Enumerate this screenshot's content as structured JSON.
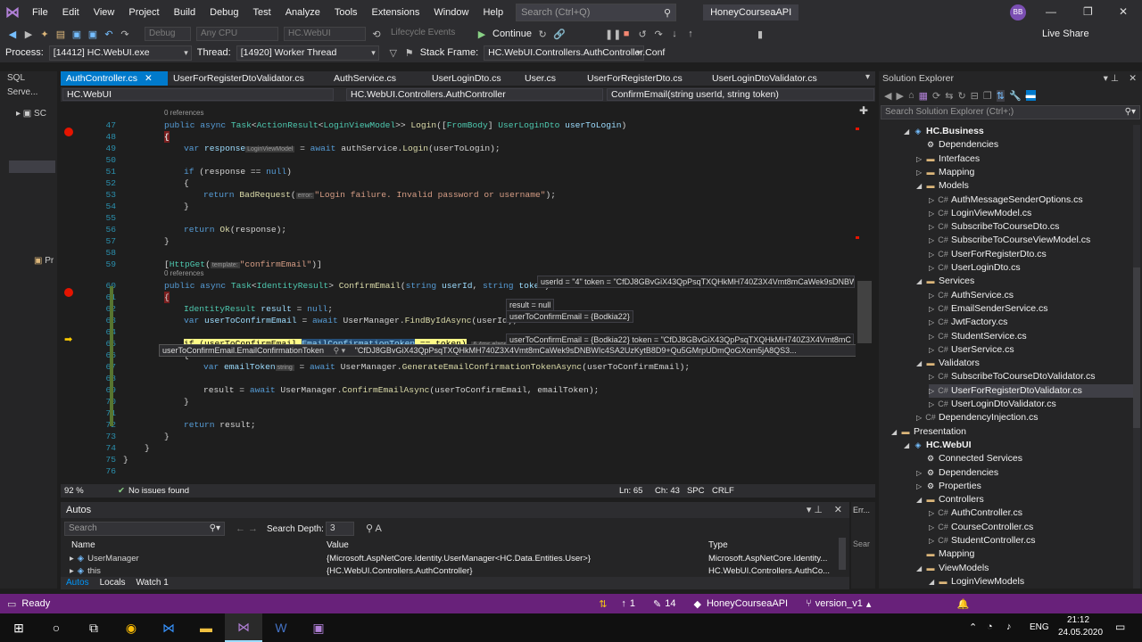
{
  "menubar": {
    "items": [
      "File",
      "Edit",
      "View",
      "Project",
      "Build",
      "Debug",
      "Test",
      "Analyze",
      "Tools",
      "Extensions",
      "Window",
      "Help"
    ],
    "search_placeholder": "Search (Ctrl+Q)",
    "solution_name": "HoneyCourseaAPI",
    "avatar_initials": "BB"
  },
  "toolbar1": {
    "config": "Debug",
    "platform": "Any CPU",
    "project": "HC.WebUI",
    "lifecycle": "Lifecycle Events",
    "continue_label": "Continue",
    "live_share": "Live Share"
  },
  "toolbar2": {
    "process_label": "Process:",
    "process_value": "[14412] HC.WebUI.exe",
    "thread_label": "Thread:",
    "thread_value": "[14920] Worker Thread",
    "stackframe_label": "Stack Frame:",
    "stackframe_value": "HC.WebUI.Controllers.AuthController.Conf"
  },
  "left_panel": {
    "title": "SQL Serve...",
    "items": [
      "SC",
      "Pr"
    ]
  },
  "tabs": [
    "AuthController.cs",
    "UserForRegisterDtoValidator.cs",
    "AuthService.cs",
    "UserLoginDto.cs",
    "User.cs",
    "UserForRegisterDto.cs",
    "UserLoginDtoValidator.cs"
  ],
  "navbar": {
    "project": "HC.WebUI",
    "class": "HC.WebUI.Controllers.AuthController",
    "member": "ConfirmEmail(string userId, string token)"
  },
  "code": {
    "refs_label": "0 references",
    "lines": [
      "47",
      "48",
      "49",
      "50",
      "51",
      "52",
      "53",
      "54",
      "55",
      "56",
      "57",
      "58",
      "59",
      "60",
      "61",
      "62",
      "63",
      "64",
      "65",
      "66",
      "67",
      "68",
      "69",
      "70",
      "71",
      "72",
      "73",
      "74",
      "75",
      "76"
    ],
    "l47": "public async Task<ActionResult<LoginViewModel>> Login([FromBody] UserLoginDto userToLogin)",
    "l49a": "var response",
    "l49hint": "LoginViewModel",
    "l49b": " = await authService.Login(userToLogin);",
    "l51": "if (response == null)",
    "l53a": "return BadRequest(",
    "l53hint": "error:",
    "l53b": "\"Login failure. Invalid password or username\");",
    "l56": "return Ok(response);",
    "l59a": "[HttpGet(",
    "l59hint": "template:",
    "l59b": "\"confirmEmail\")]",
    "l60": "public async Task<IdentityResult> ConfirmEmail(string userId, string token)",
    "l62": "IdentityResult result = null;",
    "l63": "var userToConfirmEmail = await UserManager.FindByIdAsync(userId);",
    "l65a": "if (userToConfirmEmail.",
    "l65sel": "EmailConfirmationToken",
    "l65b": " == token)",
    "l65elapsed": "6.4ms elapsed",
    "l67a": "var emailToken",
    "l67hint": "string",
    "l67b": " = await UserManager.GenerateEmailConfirmationTokenAsync(userToConfirmEmail);",
    "l69": "result = await UserManager.ConfirmEmailAsync(userToConfirmEmail, emailToken);",
    "l72": "return result;",
    "brace_open": "{",
    "brace_close": "}"
  },
  "datatips": {
    "l60": "userId = \"4\"   token = \"CfDJ8GBvGiX43QpPsqTXQHkMH740Z3X4Vmt8mCaWek9sDNBW",
    "l62": "result = null",
    "l63": "userToConfirmEmail = {Bodkia22}",
    "l65": "userToConfirmEmail = {Bodkia22}   token = \"CfDJ8GBvGiX43QpPsqTXQHkMH740Z3X4Vmt8mC",
    "hover_name": "userToConfirmEmail.EmailConfirmationToken",
    "hover_value": "\"CfDJ8GBvGiX43QpPsqTXQHkMH740Z3X4Vmt8mCaWek9sDNBWIc4SA2UzKytB8D9+Qu5GMrpUDmQoGXom5jA8QS3..."
  },
  "editor_status": {
    "zoom": "92 %",
    "issues": "No issues found",
    "ln": "Ln: 65",
    "ch": "Ch: 43",
    "spc": "SPC",
    "crlf": "CRLF"
  },
  "autos": {
    "title": "Autos",
    "search_placeholder": "Search",
    "depth_label": "Search Depth:",
    "depth_value": "3",
    "columns": [
      "Name",
      "Value",
      "Type"
    ],
    "rows": [
      {
        "name": "UserManager",
        "value": "{Microsoft.AspNetCore.Identity.UserManager<HC.Data.Entities.User>}",
        "type": "Microsoft.AspNetCore.Identity..."
      },
      {
        "name": "this",
        "value": "{HC.WebUI.Controllers.AuthController}",
        "type": "HC.WebUI.Controllers.AuthCo..."
      }
    ],
    "tabs": [
      "Autos",
      "Locals",
      "Watch 1"
    ],
    "err_label": "Err...",
    "err_search": "Sear"
  },
  "solution_explorer": {
    "title": "Solution Explorer",
    "search_placeholder": "Search Solution Explorer (Ctrl+;)",
    "nodes": [
      {
        "label": "HC.Business",
        "kind": "proj"
      },
      {
        "label": "Dependencies",
        "kind": "dep"
      },
      {
        "label": "Interfaces",
        "kind": "folder"
      },
      {
        "label": "Mapping",
        "kind": "folder"
      },
      {
        "label": "Models",
        "kind": "folder"
      },
      {
        "label": "AuthMessageSenderOptions.cs",
        "kind": "cs"
      },
      {
        "label": "LoginViewModel.cs",
        "kind": "cs"
      },
      {
        "label": "SubscribeToCourseDto.cs",
        "kind": "cs"
      },
      {
        "label": "SubscribeToCourseViewModel.cs",
        "kind": "cs"
      },
      {
        "label": "UserForRegisterDto.cs",
        "kind": "cs"
      },
      {
        "label": "UserLoginDto.cs",
        "kind": "cs"
      },
      {
        "label": "Services",
        "kind": "folder"
      },
      {
        "label": "AuthService.cs",
        "kind": "cs"
      },
      {
        "label": "EmailSenderService.cs",
        "kind": "cs"
      },
      {
        "label": "JwtFactory.cs",
        "kind": "cs"
      },
      {
        "label": "StudentService.cs",
        "kind": "cs"
      },
      {
        "label": "UserService.cs",
        "kind": "cs"
      },
      {
        "label": "Validators",
        "kind": "folder"
      },
      {
        "label": "SubscribeToCourseDtoValidator.cs",
        "kind": "cs"
      },
      {
        "label": "UserForRegisterDtoValidator.cs",
        "kind": "cs"
      },
      {
        "label": "UserLoginDtoValidator.cs",
        "kind": "cs"
      },
      {
        "label": "DependencyInjection.cs",
        "kind": "cs"
      },
      {
        "label": "Presentation",
        "kind": "folder"
      },
      {
        "label": "HC.WebUI",
        "kind": "proj"
      },
      {
        "label": "Connected Services",
        "kind": "dep"
      },
      {
        "label": "Dependencies",
        "kind": "dep"
      },
      {
        "label": "Properties",
        "kind": "dep"
      },
      {
        "label": "Controllers",
        "kind": "folder"
      },
      {
        "label": "AuthController.cs",
        "kind": "cs"
      },
      {
        "label": "CourseController.cs",
        "kind": "cs"
      },
      {
        "label": "StudentController.cs",
        "kind": "cs"
      },
      {
        "label": "Mapping",
        "kind": "folder"
      },
      {
        "label": "ViewModels",
        "kind": "folder"
      },
      {
        "label": "LoginViewModels",
        "kind": "folder"
      }
    ]
  },
  "statusbar": {
    "ready": "Ready",
    "up": "1",
    "changes": "14",
    "repo": "HoneyCourseaAPI",
    "branch": "version_v1"
  },
  "taskbar": {
    "lang": "ENG",
    "time": "21:12",
    "date": "24.05.2020"
  },
  "colors": {
    "accent": "#007acc",
    "vs_purple": "#68217a",
    "breakpoint": "#e51400"
  }
}
